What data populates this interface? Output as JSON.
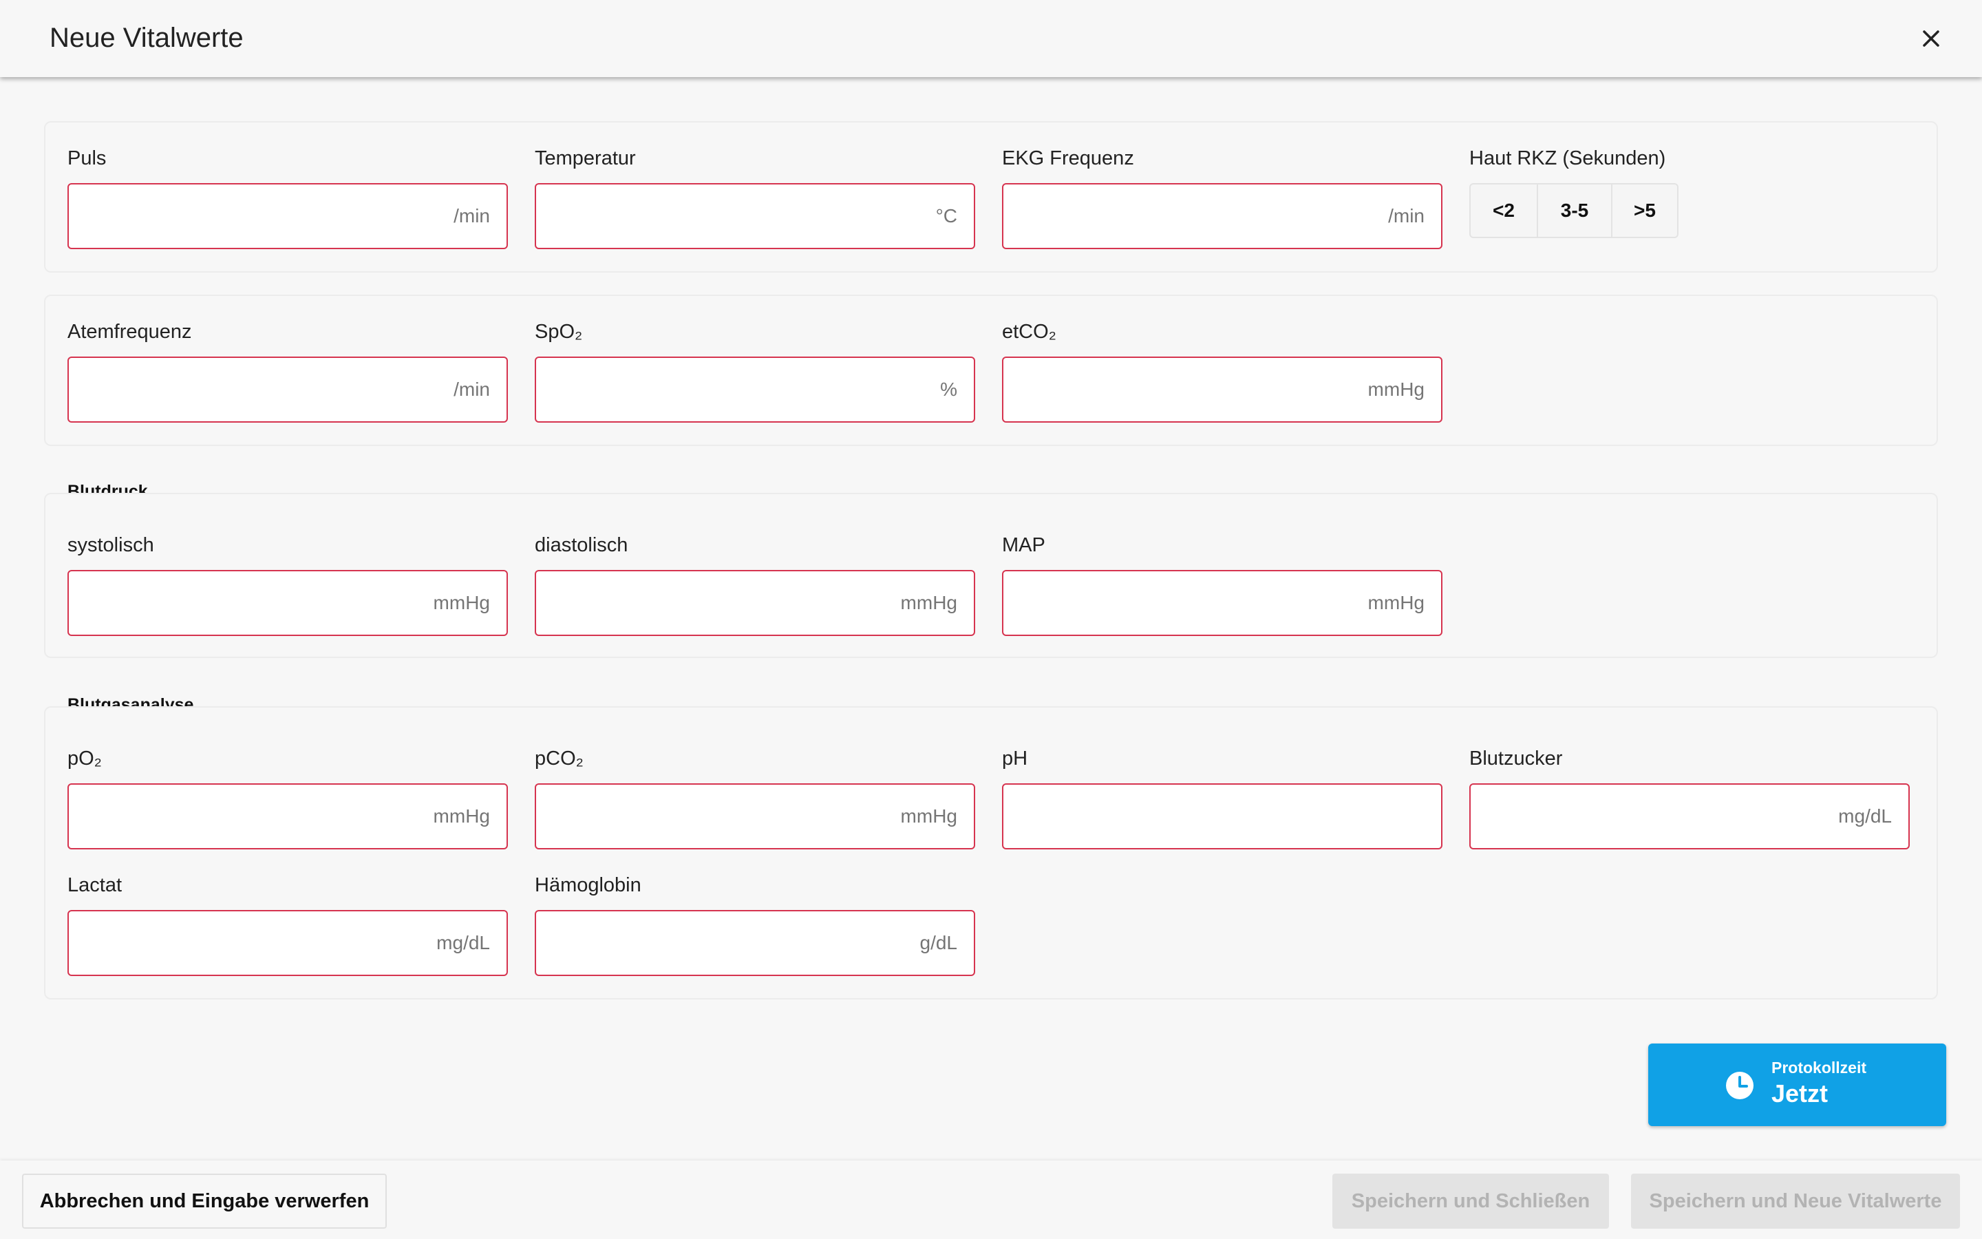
{
  "header": {
    "title": "Neue Vitalwerte",
    "close_icon": "close-icon"
  },
  "row1": {
    "puls": {
      "label": "Puls",
      "unit": "/min"
    },
    "temperatur": {
      "label": "Temperatur",
      "unit": "°C"
    },
    "ekg": {
      "label": "EKG Frequenz",
      "unit": "/min"
    },
    "rkz": {
      "label": "Haut RKZ (Sekunden)",
      "options": [
        "<2",
        "3-5",
        ">5"
      ]
    }
  },
  "row2": {
    "atemfrequenz": {
      "label": "Atemfrequenz",
      "unit": "/min"
    },
    "spo2": {
      "label": "SpO₂",
      "unit": "%"
    },
    "etco2": {
      "label": "etCO₂",
      "unit": "mmHg"
    }
  },
  "blutdruck": {
    "title": "Blutdruck",
    "systolisch": {
      "label": "systolisch",
      "unit": "mmHg"
    },
    "diastolisch": {
      "label": "diastolisch",
      "unit": "mmHg"
    },
    "map": {
      "label": "MAP",
      "unit": "mmHg"
    }
  },
  "blutgas": {
    "title": "Blutgasanalyse",
    "po2": {
      "label": "pO₂",
      "unit": "mmHg"
    },
    "pco2": {
      "label": "pCO₂",
      "unit": "mmHg"
    },
    "ph": {
      "label": "pH",
      "unit": ""
    },
    "blutzucker": {
      "label": "Blutzucker",
      "unit": "mg/dL"
    },
    "lactat": {
      "label": "Lactat",
      "unit": "mg/dL"
    },
    "haemoglobin": {
      "label": "Hämoglobin",
      "unit": "g/dL"
    }
  },
  "protokollzeit": {
    "label": "Protokollzeit",
    "value": "Jetzt",
    "icon": "clock-icon"
  },
  "footer": {
    "cancel": "Abbrechen und Eingabe verwerfen",
    "save_close": "Speichern und Schließen",
    "save_new": "Speichern und Neue Vitalwerte"
  },
  "colors": {
    "accent": "#10a1e6",
    "invalid_border": "#d6344f",
    "disabled_bg": "#e3e3e3",
    "disabled_text": "#b3b3b3"
  }
}
